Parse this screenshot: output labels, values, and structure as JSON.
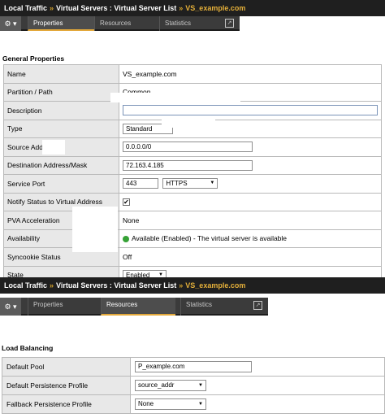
{
  "top": {
    "breadcrumb": {
      "part1": "Local Traffic",
      "sep": "»",
      "part2": "Virtual Servers : Virtual Server List",
      "sep2": "»",
      "current": "VS_example.com"
    },
    "tabs": {
      "properties": "Properties",
      "resources": "Resources",
      "statistics": "Statistics"
    }
  },
  "general": {
    "title": "General Properties",
    "rows": {
      "name": {
        "label": "Name",
        "value": "VS_example.com"
      },
      "partition": {
        "label": "Partition / Path",
        "value": "Common"
      },
      "description": {
        "label": "Description",
        "value": ""
      },
      "type": {
        "label": "Type",
        "value": "Standard"
      },
      "source": {
        "label": "Source Address",
        "value": "0.0.0.0/0"
      },
      "destination": {
        "label": "Destination Address/Mask",
        "value": "72.163.4.185"
      },
      "port": {
        "label": "Service Port",
        "value": "443",
        "protocol": "HTTPS"
      },
      "notify": {
        "label": "Notify Status to Virtual Address",
        "check": "✔"
      },
      "pva": {
        "label": "PVA Acceleration",
        "value": "None"
      },
      "availability": {
        "label": "Availability",
        "value": "Available (Enabled) - The virtual server is available"
      },
      "syncookie": {
        "label": "Syncookie Status",
        "value": "Off"
      },
      "state": {
        "label": "State",
        "value": "Enabled"
      }
    }
  },
  "bottom": {
    "breadcrumb": {
      "part1": "Local Traffic",
      "sep": "»",
      "part2": "Virtual Servers : Virtual Server List",
      "sep2": "»",
      "current": "VS_example.com"
    },
    "tabs": {
      "properties": "Properties",
      "resources": "Resources",
      "statistics": "Statistics"
    }
  },
  "lb": {
    "title": "Load Balancing",
    "rows": {
      "pool": {
        "label": "Default Pool",
        "value": "P_example.com"
      },
      "persistence": {
        "label": "Default Persistence Profile",
        "value": "source_addr"
      },
      "fallback": {
        "label": "Fallback Persistence Profile",
        "value": "None"
      }
    }
  },
  "icons": {
    "gear": "gear-icon",
    "popout": "popout-icon"
  },
  "colors": {
    "accent": "#e3a83a",
    "titlebar": "#1f1f1f",
    "available": "#36a236"
  }
}
